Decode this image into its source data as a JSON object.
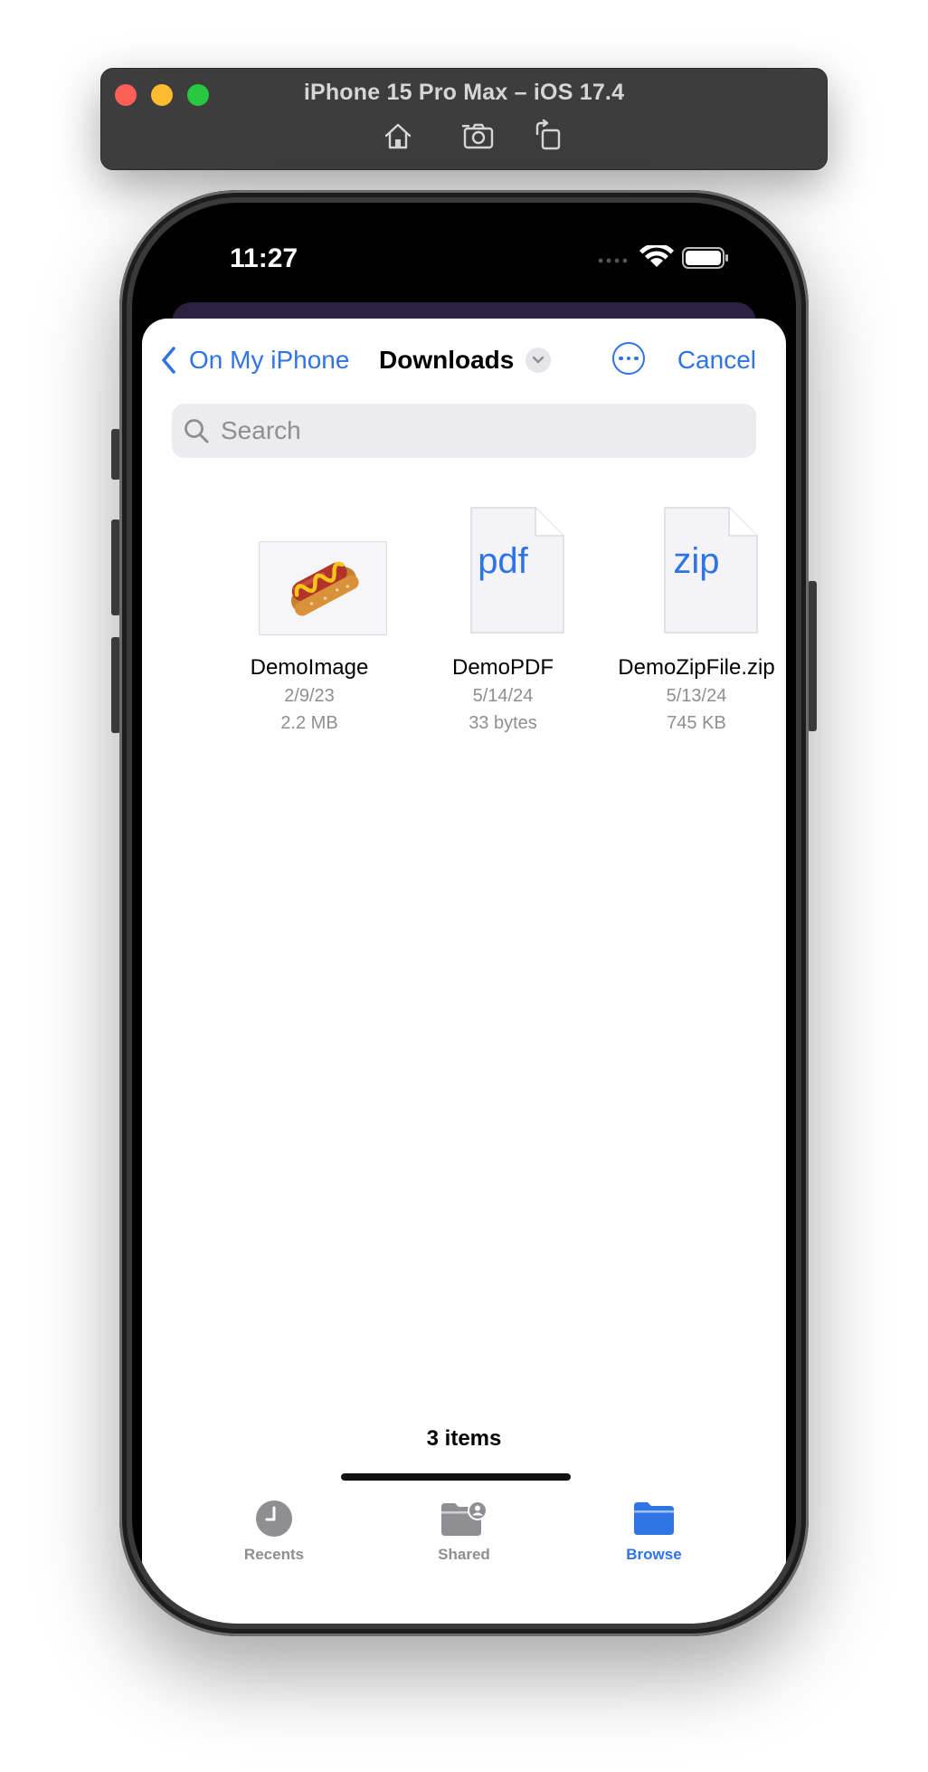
{
  "simulator": {
    "title": "iPhone 15 Pro Max – iOS 17.4",
    "tools": [
      "home-icon",
      "screenshot-icon",
      "rotate-icon"
    ]
  },
  "status_bar": {
    "time": "11:27"
  },
  "nav": {
    "back_label": "On My iPhone",
    "title": "Downloads",
    "cancel_label": "Cancel"
  },
  "search": {
    "placeholder": "Search",
    "value": ""
  },
  "files": [
    {
      "name": "DemoImage",
      "date": "2/9/23",
      "size": "2.2 MB",
      "thumb": "hotdog-image"
    },
    {
      "name": "DemoPDF",
      "date": "5/14/24",
      "size": "33 bytes",
      "thumb_label": "pdf"
    },
    {
      "name": "DemoZipFile.zip",
      "date": "5/13/24",
      "size": "745 KB",
      "thumb_label": "zip"
    }
  ],
  "footer": {
    "item_count": "3 items"
  },
  "tabs": [
    {
      "label": "Recents",
      "icon": "clock-icon",
      "active": false
    },
    {
      "label": "Shared",
      "icon": "shared-folder-icon",
      "active": false
    },
    {
      "label": "Browse",
      "icon": "folder-icon",
      "active": true
    }
  ],
  "colors": {
    "accent": "#2f74e6",
    "secondary_text": "#8e8e93"
  }
}
